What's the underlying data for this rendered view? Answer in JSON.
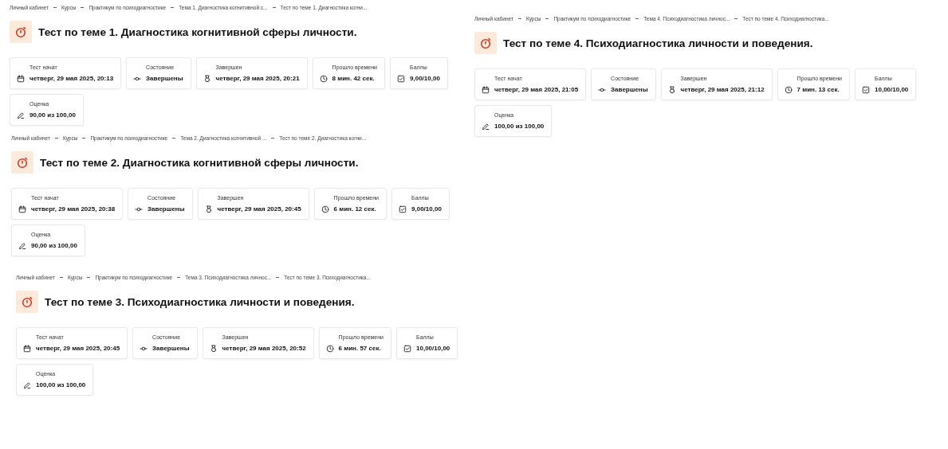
{
  "panels": [
    {
      "breadcrumbs": [
        "Личный кабинет",
        "Курсы",
        "Практикум по психодиагностике",
        "Тема 1. Диагностика когнитивной с...",
        "Тест по теме 1. Диагностика когни..."
      ],
      "title": "Тест по теме 1. Диагностика когнитивной сферы личности.",
      "fields": [
        {
          "label": "Тест начат",
          "value": "четверг, 29 мая 2025, 20:13"
        },
        {
          "label": "Состояние",
          "value": "Завершены"
        },
        {
          "label": "Завершен",
          "value": "четверг, 29 мая 2025, 20:21"
        },
        {
          "label": "Прошло времени",
          "value": "8 мин. 42 сек."
        },
        {
          "label": "Баллы",
          "value": "9,00/10,00"
        },
        {
          "label": "Оценка",
          "value": "90,00 из 100,00"
        }
      ]
    },
    {
      "breadcrumbs": [
        "Личный кабинет",
        "Курсы",
        "Практикум по психодиагностике",
        "Тема 4. Психодиагностика личнос...",
        "Тест по теме 4. Психодиагностика..."
      ],
      "title": "Тест по теме 4. Психодиагностика личности и поведения.",
      "fields": [
        {
          "label": "Тест начат",
          "value": "четверг, 29 мая 2025, 21:05"
        },
        {
          "label": "Состояние",
          "value": "Завершены"
        },
        {
          "label": "Завершен",
          "value": "четверг, 29 мая 2025, 21:12"
        },
        {
          "label": "Прошло времени",
          "value": "7 мин. 13 сек."
        },
        {
          "label": "Баллы",
          "value": "10,00/10,00"
        },
        {
          "label": "Оценка",
          "value": "100,00 из 100,00"
        }
      ]
    },
    {
      "breadcrumbs": [
        "Личный кабинет",
        "Курсы",
        "Практикум по психодиагностике",
        "Тема 2. Диагностика когнитивной ...",
        "Тест по теме 2. Диагностика когни..."
      ],
      "title": "Тест по теме 2. Диагностика когнитивной сферы личности.",
      "fields": [
        {
          "label": "Тест начат",
          "value": "четверг, 29 мая 2025, 20:38"
        },
        {
          "label": "Состояние",
          "value": "Завершены"
        },
        {
          "label": "Завершен",
          "value": "четверг, 29 мая 2025, 20:45"
        },
        {
          "label": "Прошло времени",
          "value": "6 мин. 12 сек."
        },
        {
          "label": "Баллы",
          "value": "9,00/10,00"
        },
        {
          "label": "Оценка",
          "value": "90,00 из 100,00"
        }
      ]
    },
    {
      "breadcrumbs": [
        "Личный кабинет",
        "Курсы",
        "Практикум по психодиагностике",
        "Тема 3. Психодиагностика личнос...",
        "Тест по теме 3. Психодиагностика..."
      ],
      "title": "Тест по теме 3. Психодиагностика личности и поведения.",
      "fields": [
        {
          "label": "Тест начат",
          "value": "четверг, 29 мая 2025, 20:45"
        },
        {
          "label": "Состояние",
          "value": "Завершены"
        },
        {
          "label": "Завершен",
          "value": "четверг, 29 мая 2025, 20:52"
        },
        {
          "label": "Прошло времени",
          "value": "6 мин. 57 сек."
        },
        {
          "label": "Баллы",
          "value": "10,00/10,00"
        },
        {
          "label": "Оценка",
          "value": "100,00 из 100,00"
        }
      ]
    }
  ]
}
